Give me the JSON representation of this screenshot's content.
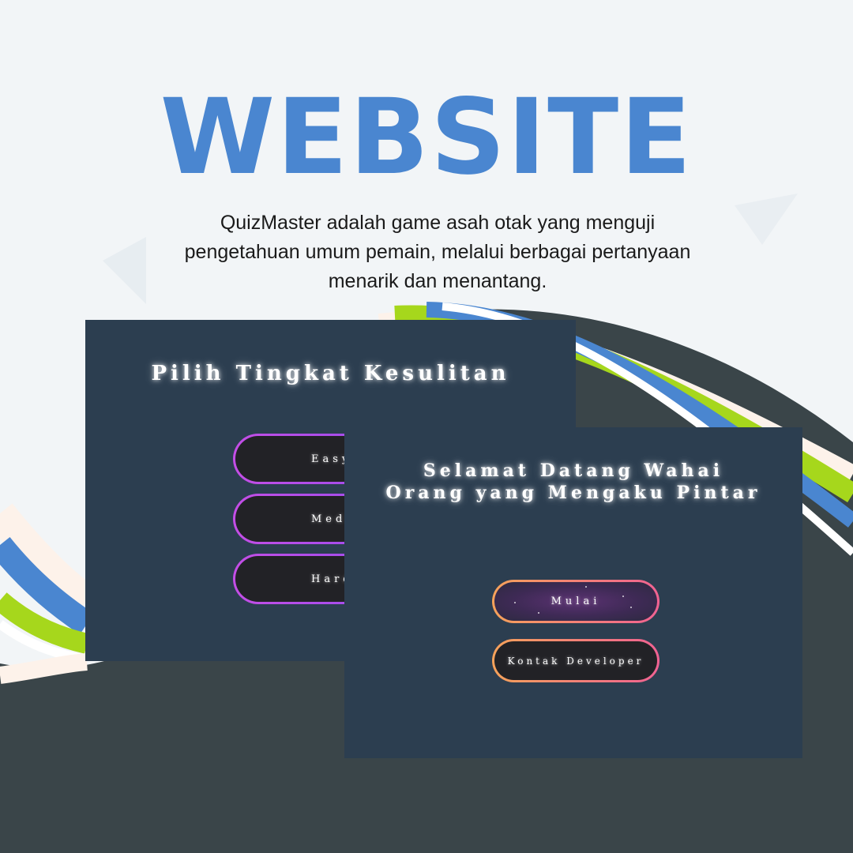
{
  "hero": {
    "title": "WEBSITE",
    "description_lines": [
      "QuizMaster adalah game asah otak yang menguji",
      "pengetahuan umum pemain, melalui berbagai pertanyaan",
      "menarik dan menantang."
    ]
  },
  "difficulty_screen": {
    "title": "Pilih Tingkat Kesulitan",
    "buttons": [
      "Easy",
      "Medium",
      "Hard"
    ]
  },
  "welcome_screen": {
    "title_lines": [
      "Selamat Datang Wahai",
      "Orang yang Mengaku Pintar"
    ],
    "buttons": [
      "Mulai",
      "Kontak Developer"
    ]
  },
  "colors": {
    "title_blue": "#4a86d0",
    "panel_bg": "#2c3e50",
    "button_bg": "#222226",
    "purple_border_start": "#c44ee6",
    "purple_border_end": "#8a4cf0",
    "orange_border_start": "#f6a25a",
    "orange_border_end": "#f06292",
    "wave_green": "#a6d71c",
    "wave_blue": "#4a86d0",
    "wave_dark": "#3a4549"
  }
}
